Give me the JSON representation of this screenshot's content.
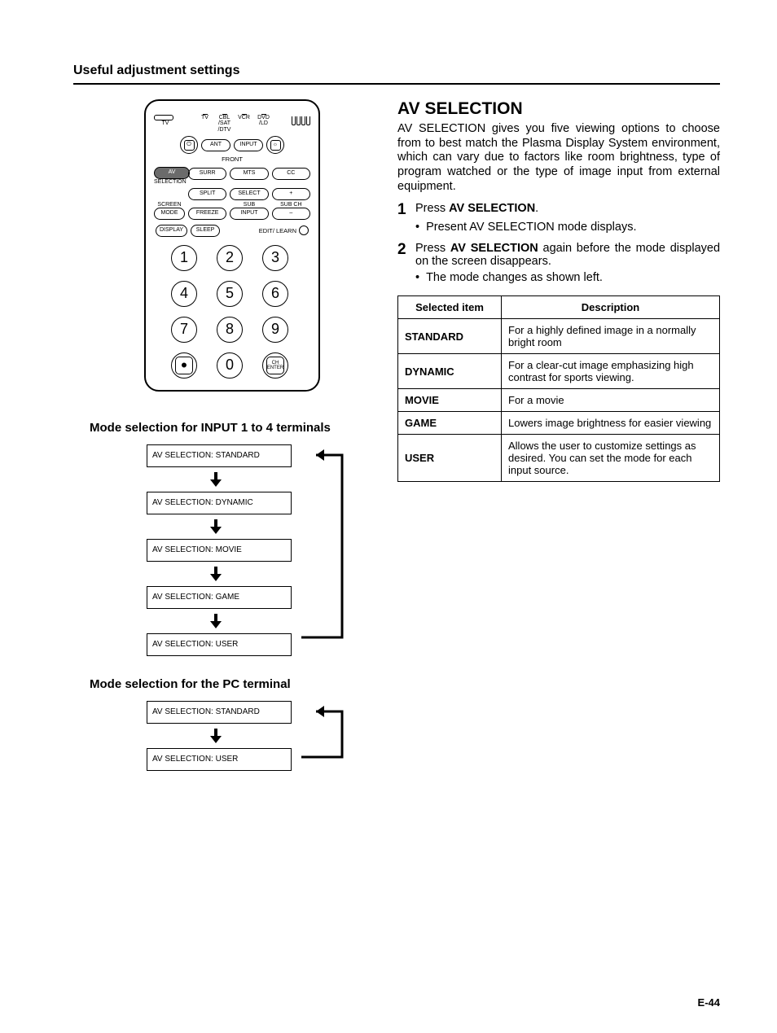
{
  "header": "Useful adjustment settings",
  "page_number": "E-44",
  "remote": {
    "top_labels": [
      "TV",
      "CBL\n/SAT\n/DTV",
      "VCR",
      "DVD\n/LD"
    ],
    "row1": {
      "ant": "ANT",
      "input": "INPUT"
    },
    "row1_under": "FRONT",
    "row2": {
      "av": "AV",
      "surr": "SURR",
      "mts": "MTS",
      "cc": "CC",
      "av_under": "SELECTION"
    },
    "row3": {
      "split": "SPLIT",
      "select": "SELECT",
      "plus": "+"
    },
    "row4": {
      "screen": "SCREEN",
      "sub": "SUB",
      "subch": "SUB CH"
    },
    "row5": {
      "mode": "MODE",
      "freeze": "FREEZE",
      "input": "INPUT",
      "minus": "–"
    },
    "row6": {
      "display": "DISPLAY",
      "sleep": "SLEEP",
      "editlearn": "EDIT/ LEARN"
    },
    "numbers": [
      "1",
      "2",
      "3",
      "4",
      "5",
      "6",
      "7",
      "8",
      "9",
      "0"
    ],
    "dot": "•",
    "ch_enter": "CH\nENTER",
    "tv_label": "TV"
  },
  "flow_input": {
    "title": "Mode selection for INPUT 1 to 4 terminals",
    "items": [
      "AV SELECTION: STANDARD",
      "AV SELECTION: DYNAMIC",
      "AV SELECTION: MOVIE",
      "AV SELECTION: GAME",
      "AV SELECTION: USER"
    ]
  },
  "flow_pc": {
    "title": "Mode selection for the PC terminal",
    "items": [
      "AV SELECTION: STANDARD",
      "AV SELECTION: USER"
    ]
  },
  "av": {
    "title": "AV SELECTION",
    "intro": "AV SELECTION gives you five viewing options to choose from to best match the Plasma Display System environment, which can vary due to factors like room brightness, type of program watched or the type of image input from external equipment.",
    "step1_pre": "Press ",
    "step1_b": "AV SELECTION",
    "step1_post": ".",
    "step1_bullet": "Present AV SELECTION mode displays.",
    "step2_pre": "Press ",
    "step2_b": "AV SELECTION",
    "step2_post": " again before the mode displayed on the screen disappears.",
    "step2_bullet": "The mode changes as shown left.",
    "table": {
      "h1": "Selected item",
      "h2": "Description",
      "rows": [
        {
          "item": "STANDARD",
          "desc": "For a highly defined image in a normally bright room"
        },
        {
          "item": "DYNAMIC",
          "desc": "For a clear-cut image emphasizing high contrast for sports viewing."
        },
        {
          "item": "MOVIE",
          "desc": "For a movie"
        },
        {
          "item": "GAME",
          "desc": "Lowers image brightness for easier viewing"
        },
        {
          "item": "USER",
          "desc": "Allows the user to customize settings as desired. You can set the mode for each input source."
        }
      ]
    }
  }
}
